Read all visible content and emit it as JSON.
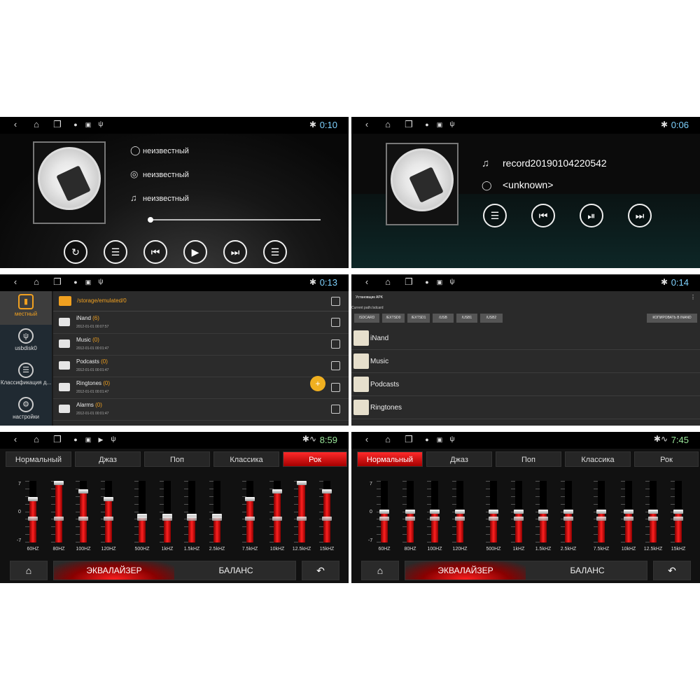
{
  "panels": {
    "music1": {
      "time": "0:10",
      "rows": [
        {
          "icon": "person-icon",
          "text": "неизвестный"
        },
        {
          "icon": "disc-icon",
          "text": "неизвестный"
        },
        {
          "icon": "music-note-icon",
          "text": "неизвестный"
        }
      ],
      "progress": 0.0,
      "controls": [
        "repeat",
        "equalizer",
        "previous",
        "play",
        "next",
        "playlist"
      ]
    },
    "music2": {
      "time": "0:06",
      "title": "record20190104220542",
      "artist": "<unknown>",
      "controls": [
        "equalizer",
        "previous",
        "play-pause",
        "next"
      ]
    },
    "files": {
      "time": "0:13",
      "sidebar": [
        "местный",
        "usbdisk0",
        "Классификация д...",
        "настройки"
      ],
      "path": "/storage/emulated/0",
      "items": [
        {
          "name": "iNand",
          "count": "(6)",
          "date": "2012-01-01 00:07:57"
        },
        {
          "name": "Music",
          "count": "(0)",
          "date": "2012-01-01 00:01:47"
        },
        {
          "name": "Podcasts",
          "count": "(0)",
          "date": "2012-01-01 00:01:47"
        },
        {
          "name": "Ringtones",
          "count": "(0)",
          "date": "2012-01-01 00:01:47"
        },
        {
          "name": "Alarms",
          "count": "(0)",
          "date": "2012-01-01 00:01:47"
        }
      ]
    },
    "apk": {
      "time": "0:14",
      "title": "Установщик APK",
      "current_path": "Current path:/sdcard",
      "buttons": [
        "/SDCARD",
        "/EXTSD0",
        "/EXTSD1",
        "/USB",
        "/USB1",
        "/USB2"
      ],
      "copy_button": "КОПИРОВАТЬ В INAND",
      "items": [
        "iNand",
        "Music",
        "Podcasts",
        "Ringtones"
      ]
    },
    "eq1": {
      "time": "8:59",
      "presets": [
        "Нормальный",
        "Джаз",
        "Поп",
        "Классика",
        "Рок"
      ],
      "active_preset": "Рок",
      "axis": [
        "7",
        "0",
        "-7"
      ],
      "bands": [
        {
          "label": "60HZ",
          "level": 3
        },
        {
          "label": "80HZ",
          "level": 7
        },
        {
          "label": "100HZ",
          "level": 5
        },
        {
          "label": "120HZ",
          "level": 3
        },
        {
          "label": "500HZ",
          "level": -1
        },
        {
          "label": "1kHZ",
          "level": -1
        },
        {
          "label": "1.5kHZ",
          "level": -1
        },
        {
          "label": "2.5kHZ",
          "level": -1
        },
        {
          "label": "7.5kHZ",
          "level": 3
        },
        {
          "label": "10kHZ",
          "level": 5
        },
        {
          "label": "12.5kHZ",
          "level": 7
        },
        {
          "label": "15kHZ",
          "level": 5
        }
      ],
      "mode_eq": "ЭКВАЛАЙЗЕР",
      "mode_balance": "БАЛАНС"
    },
    "eq2": {
      "time": "7:45",
      "presets": [
        "Нормальный",
        "Джаз",
        "Поп",
        "Классика",
        "Рок"
      ],
      "active_preset": "Нормальный",
      "axis": [
        "7",
        "0",
        "-7"
      ],
      "bands": [
        {
          "label": "60HZ",
          "level": 0
        },
        {
          "label": "80HZ",
          "level": 0
        },
        {
          "label": "100HZ",
          "level": 0
        },
        {
          "label": "120HZ",
          "level": 0
        },
        {
          "label": "500HZ",
          "level": 0
        },
        {
          "label": "1kHZ",
          "level": 0
        },
        {
          "label": "1.5kHZ",
          "level": 0
        },
        {
          "label": "2.5kHZ",
          "level": 0
        },
        {
          "label": "7.5kHZ",
          "level": 0
        },
        {
          "label": "10kHZ",
          "level": 0
        },
        {
          "label": "12.5kHZ",
          "level": 0
        },
        {
          "label": "15kHZ",
          "level": 0
        }
      ],
      "mode_eq": "ЭКВАЛАЙЗЕР",
      "mode_balance": "БАЛАНС"
    }
  },
  "colors": {
    "accent_time": "#7fd3ff",
    "file_accent": "#f0a020",
    "eq_red": "#ff2020"
  }
}
